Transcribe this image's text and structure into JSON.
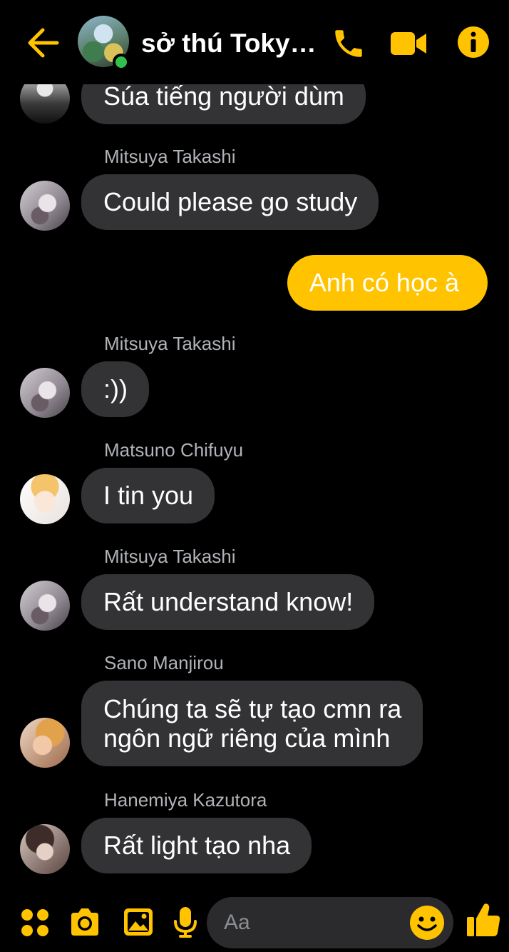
{
  "colors": {
    "accent": "#FFC300",
    "background": "#000000",
    "incoming_bubble": "#333335",
    "sender_name": "#B0B3B8",
    "online": "#31C24D"
  },
  "header": {
    "back_icon": "arrow-left-icon",
    "title": "sở thú Tokyo...",
    "call_icon": "phone-icon",
    "video_icon": "video-camera-icon",
    "info_icon": "info-icon"
  },
  "messages": [
    {
      "direction": "incoming",
      "sender": "",
      "text": "Súa tiếng người dùm"
    },
    {
      "direction": "incoming",
      "sender": "Mitsuya Takashi",
      "text": "Could please go study"
    },
    {
      "direction": "outgoing",
      "sender": "",
      "text": "Anh có học à"
    },
    {
      "direction": "incoming",
      "sender": "Mitsuya Takashi",
      "text": ":))"
    },
    {
      "direction": "incoming",
      "sender": "Matsuno Chifuyu",
      "text": "I tin you"
    },
    {
      "direction": "incoming",
      "sender": "Mitsuya Takashi",
      "text": "Rất understand know!"
    },
    {
      "direction": "incoming",
      "sender": "Sano Manjirou",
      "text_lines": [
        "Chúng ta sẽ tự tạo cmn ra",
        "ngôn ngữ riêng của mình"
      ]
    },
    {
      "direction": "incoming",
      "sender": "Hanemiya Kazutora",
      "text": "Rất light tạo nha"
    }
  ],
  "composer": {
    "placeholder": "Aa",
    "value": "",
    "icons": [
      "apps-icon",
      "camera-icon",
      "image-icon",
      "microphone-icon",
      "emoji-icon",
      "thumbs-up-icon"
    ]
  }
}
